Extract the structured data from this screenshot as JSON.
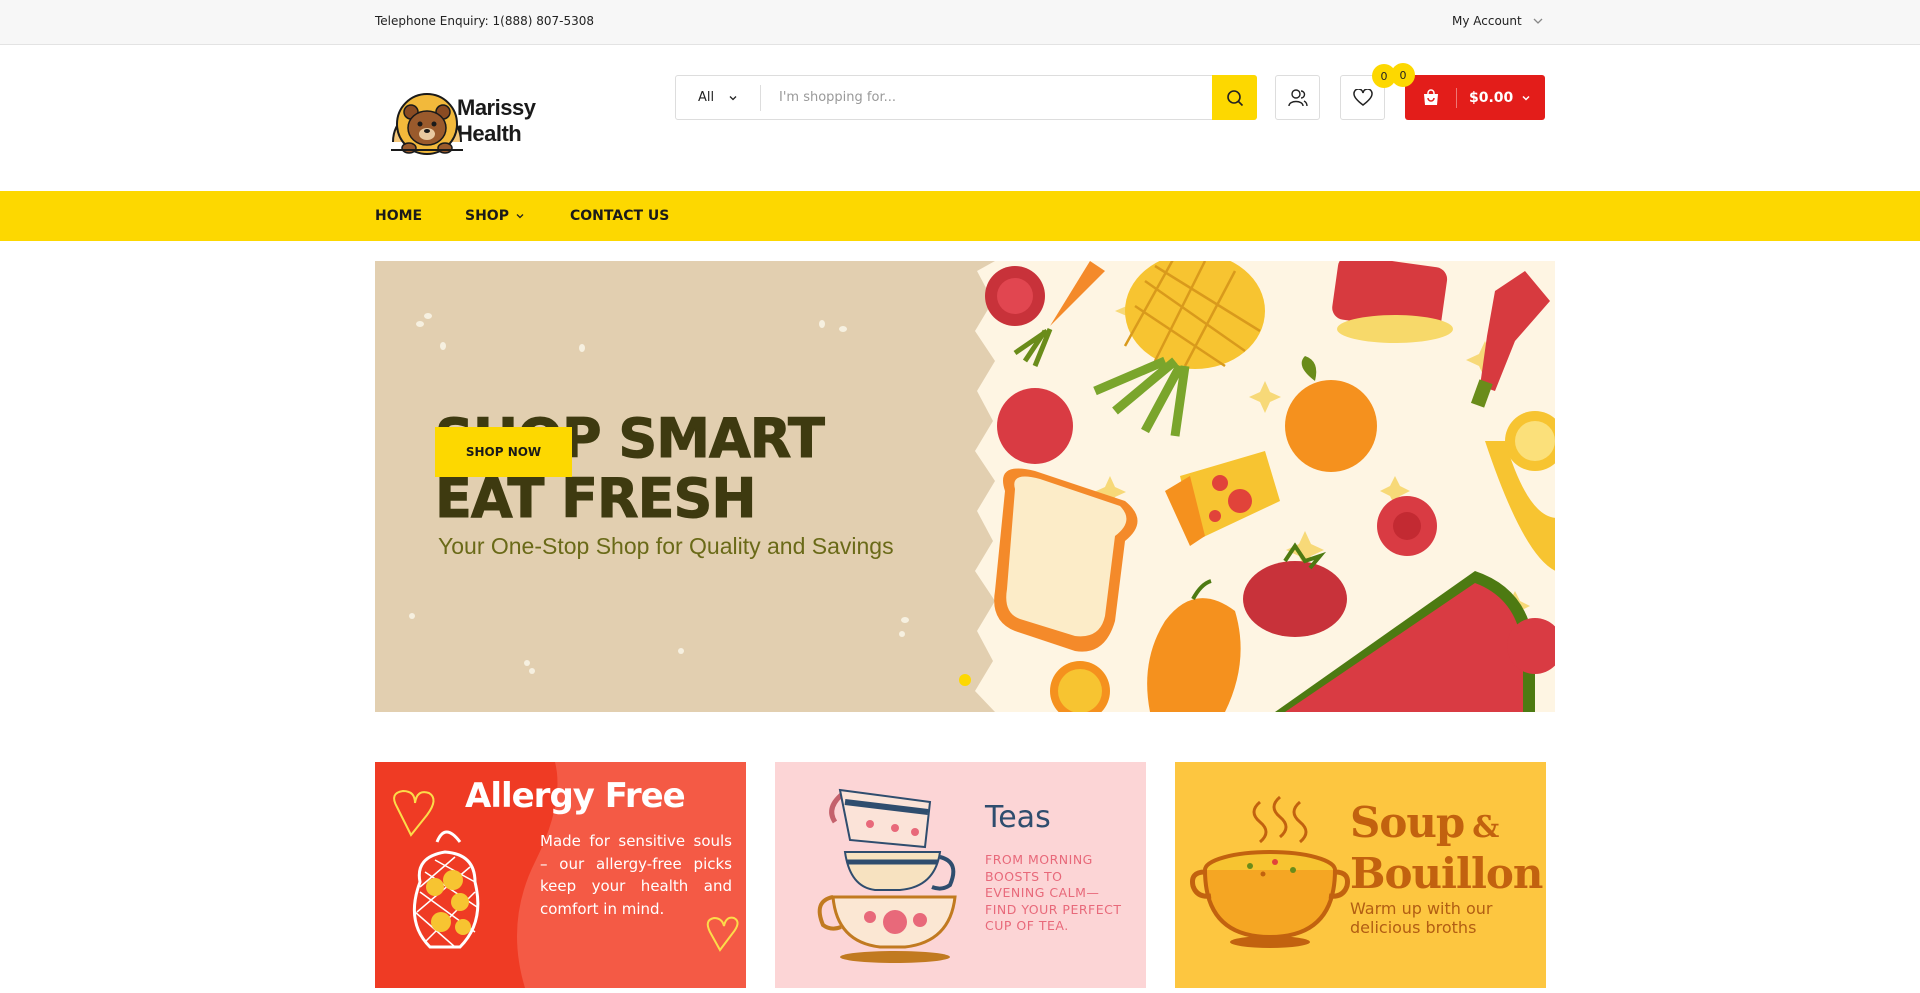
{
  "topbar": {
    "phone": "Telephone Enquiry: 1(888) 807-5308",
    "account": "My Account"
  },
  "logo": {
    "line1": "Marissy",
    "line2": "Health"
  },
  "search": {
    "category": "All",
    "placeholder": "I'm shopping for..."
  },
  "header": {
    "wishlist_count": "0",
    "cart_count": "0",
    "cart_total": "$0.00"
  },
  "nav": {
    "home": "HOME",
    "shop": "SHOP",
    "contact": "CONTACT US"
  },
  "hero": {
    "line1": "SHOP SMART",
    "line2": "EAT FRESH",
    "subtitle": "Your One-Stop Shop for Quality and Savings",
    "cta": "SHOP NOW"
  },
  "banners": [
    {
      "title": "Allergy Free",
      "desc": "Made for sensitive souls – our allergy-free picks keep your health and comfort in mind."
    },
    {
      "title": "Teas",
      "desc": "FROM MORNING BOOSTS TO EVENING CALM—FIND YOUR PERFECT CUP OF TEA."
    },
    {
      "title_a": "Soup",
      "amp": "&",
      "title_b": "Bouillon",
      "desc": "Warm up with our delicious broths"
    }
  ],
  "colors": {
    "accent": "#fdd800",
    "cart": "#e31d1a",
    "hero_bg": "#e2cfb0"
  }
}
